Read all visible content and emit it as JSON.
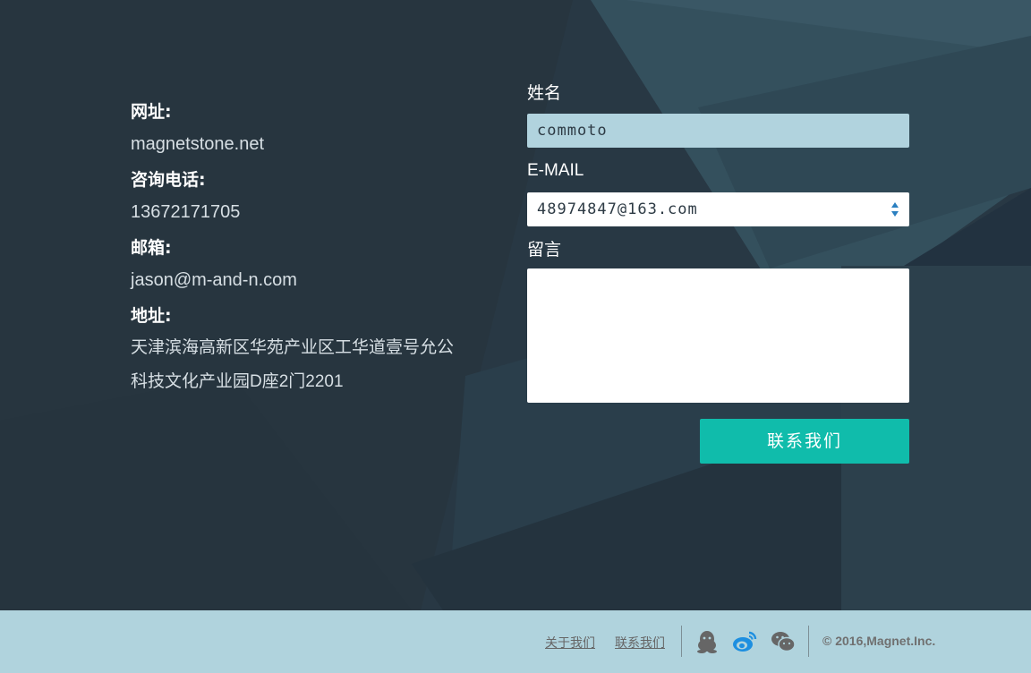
{
  "contact_info": {
    "website_label": "网址:",
    "website_value": "magnetstone.net",
    "phone_label": "咨询电话:",
    "phone_value": "13672171705",
    "email_label": "邮箱:",
    "email_value": "jason@m-and-n.com",
    "address_label": "地址:",
    "address_line1": "天津滨海高新区华苑产业区工华道壹号允公",
    "address_line2": "科技文化产业园D座2门2201"
  },
  "form": {
    "name_label": "姓名",
    "name_value": "commoto",
    "email_label": "E-MAIL",
    "email_value": "48974847@163.com",
    "message_label": "留言",
    "message_value": "",
    "submit_label": "联系我们"
  },
  "footer": {
    "about_link": "关于我们",
    "contact_link": "联系我们",
    "icons": [
      "qq-icon",
      "weibo-icon",
      "wechat-icon"
    ],
    "copyright": "© 2016,Magnet.Inc."
  },
  "colors": {
    "background": "#263642",
    "accent": "#10bcab",
    "footer": "#b0d3dd",
    "name_field": "#b1d3de"
  }
}
